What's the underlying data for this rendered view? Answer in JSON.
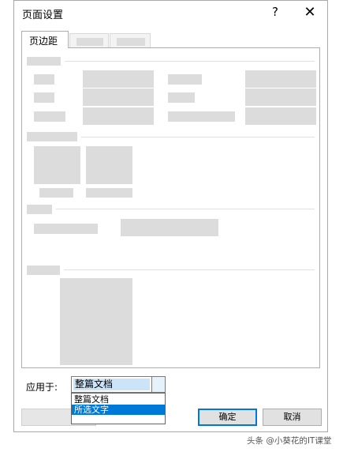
{
  "window": {
    "title": "页面设置",
    "help_glyph": "?",
    "close_glyph": "✕"
  },
  "tabs": [
    {
      "label": "页边距",
      "active": true
    }
  ],
  "apply_to": {
    "label": "应用于:",
    "selected": "整篇文档",
    "options": [
      "整篇文档",
      "所选文字"
    ],
    "highlighted_option": "所选文字"
  },
  "buttons": {
    "ok": "确定",
    "cancel": "取消"
  },
  "watermark": "头条 @小葵花的IT课堂",
  "colors": {
    "accent": "#0078d7",
    "placeholder": "#dcdcdc"
  }
}
